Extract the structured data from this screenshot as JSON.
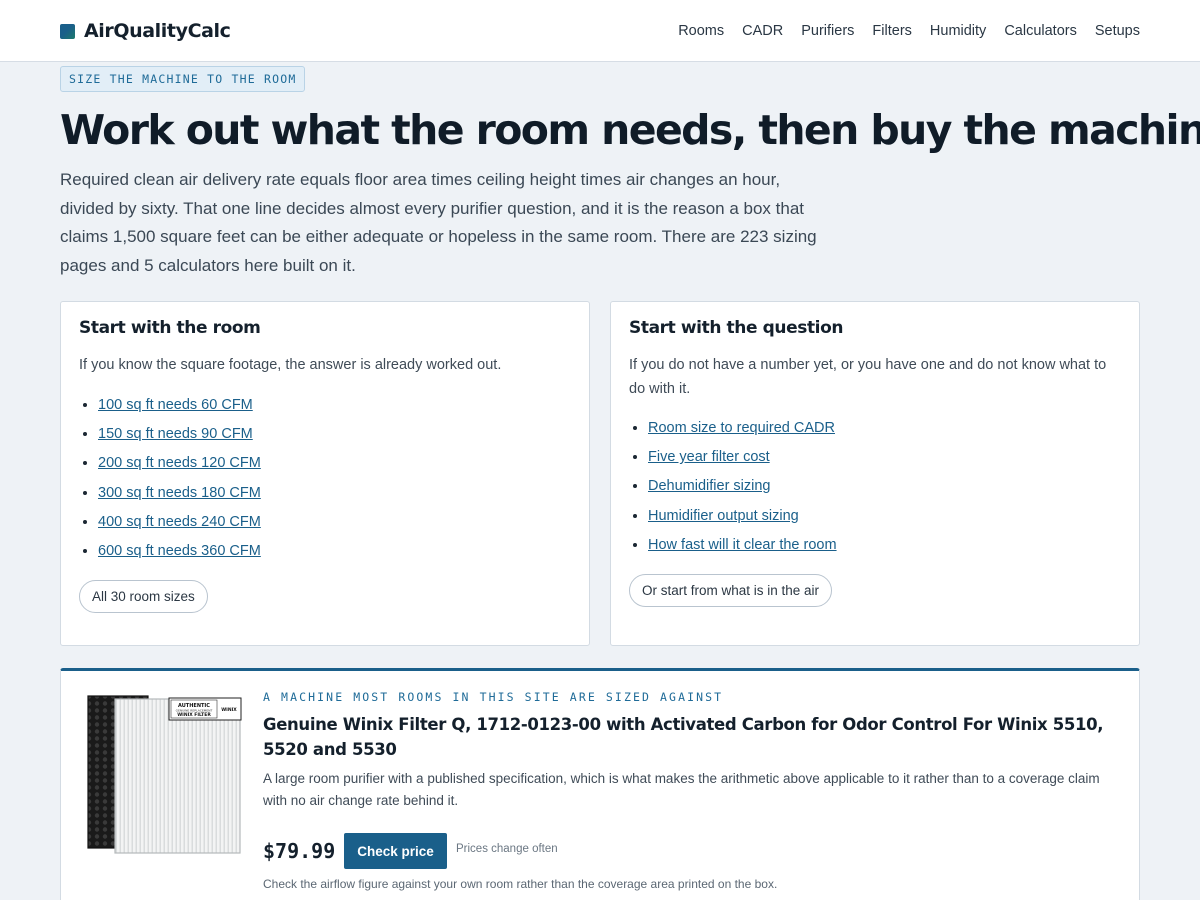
{
  "header": {
    "brand": "AirQualityCalc",
    "nav": [
      "Rooms",
      "CADR",
      "Purifiers",
      "Filters",
      "Humidity",
      "Calculators",
      "Setups"
    ]
  },
  "hero": {
    "kicker": "SIZE THE MACHINE TO THE ROOM",
    "title": "Work out what the room needs, then buy the machine",
    "lead": "Required clean air delivery rate equals floor area times ceiling height times air changes an hour, divided by sixty. That one line decides almost every purifier question, and it is the reason a box that claims 1,500 square feet can be either adequate or hopeless in the same room. There are 223 sizing pages and 5 calculators here built on it."
  },
  "room_card": {
    "title": "Start with the room",
    "desc": "If you know the square footage, the answer is already worked out.",
    "links": [
      "100 sq ft needs 60 CFM",
      "150 sq ft needs 90 CFM",
      "200 sq ft needs 120 CFM",
      "300 sq ft needs 180 CFM",
      "400 sq ft needs 240 CFM",
      "600 sq ft needs 360 CFM"
    ],
    "button": "All 30 room sizes"
  },
  "question_card": {
    "title": "Start with the question",
    "desc": "If you do not have a number yet, or you have one and do not know what to do with it.",
    "links": [
      "Room size to required CADR",
      "Five year filter cost",
      "Dehumidifier sizing",
      "Humidifier output sizing",
      "How fast will it clear the room"
    ],
    "button": "Or start from what is in the air"
  },
  "product": {
    "kicker": "A MACHINE MOST ROOMS IN THIS SITE ARE SIZED AGAINST",
    "title": "Genuine Winix Filter Q, 1712-0123-00 with Activated Carbon for Odor Control For Winix 5510, 5520 and 5530",
    "desc": "A large room purifier with a published specification, which is what makes the arithmetic above applicable to it rather than to a coverage claim with no air change rate behind it.",
    "price": "$79.99",
    "button": "Check price",
    "price_note": "Prices change often",
    "footnote": "Check the airflow figure against your own room rather than the coverage area printed on the box.",
    "image_label_line1": "AUTHENTIC",
    "image_label_line2": "WINIX FILTER",
    "image_label_small": "GENUINE REPLACEMENT",
    "image_tag": "WINIX"
  },
  "colors": {
    "accent": "#1a5f8a",
    "ink": "#14202c",
    "page_bg": "#eef2f6"
  }
}
